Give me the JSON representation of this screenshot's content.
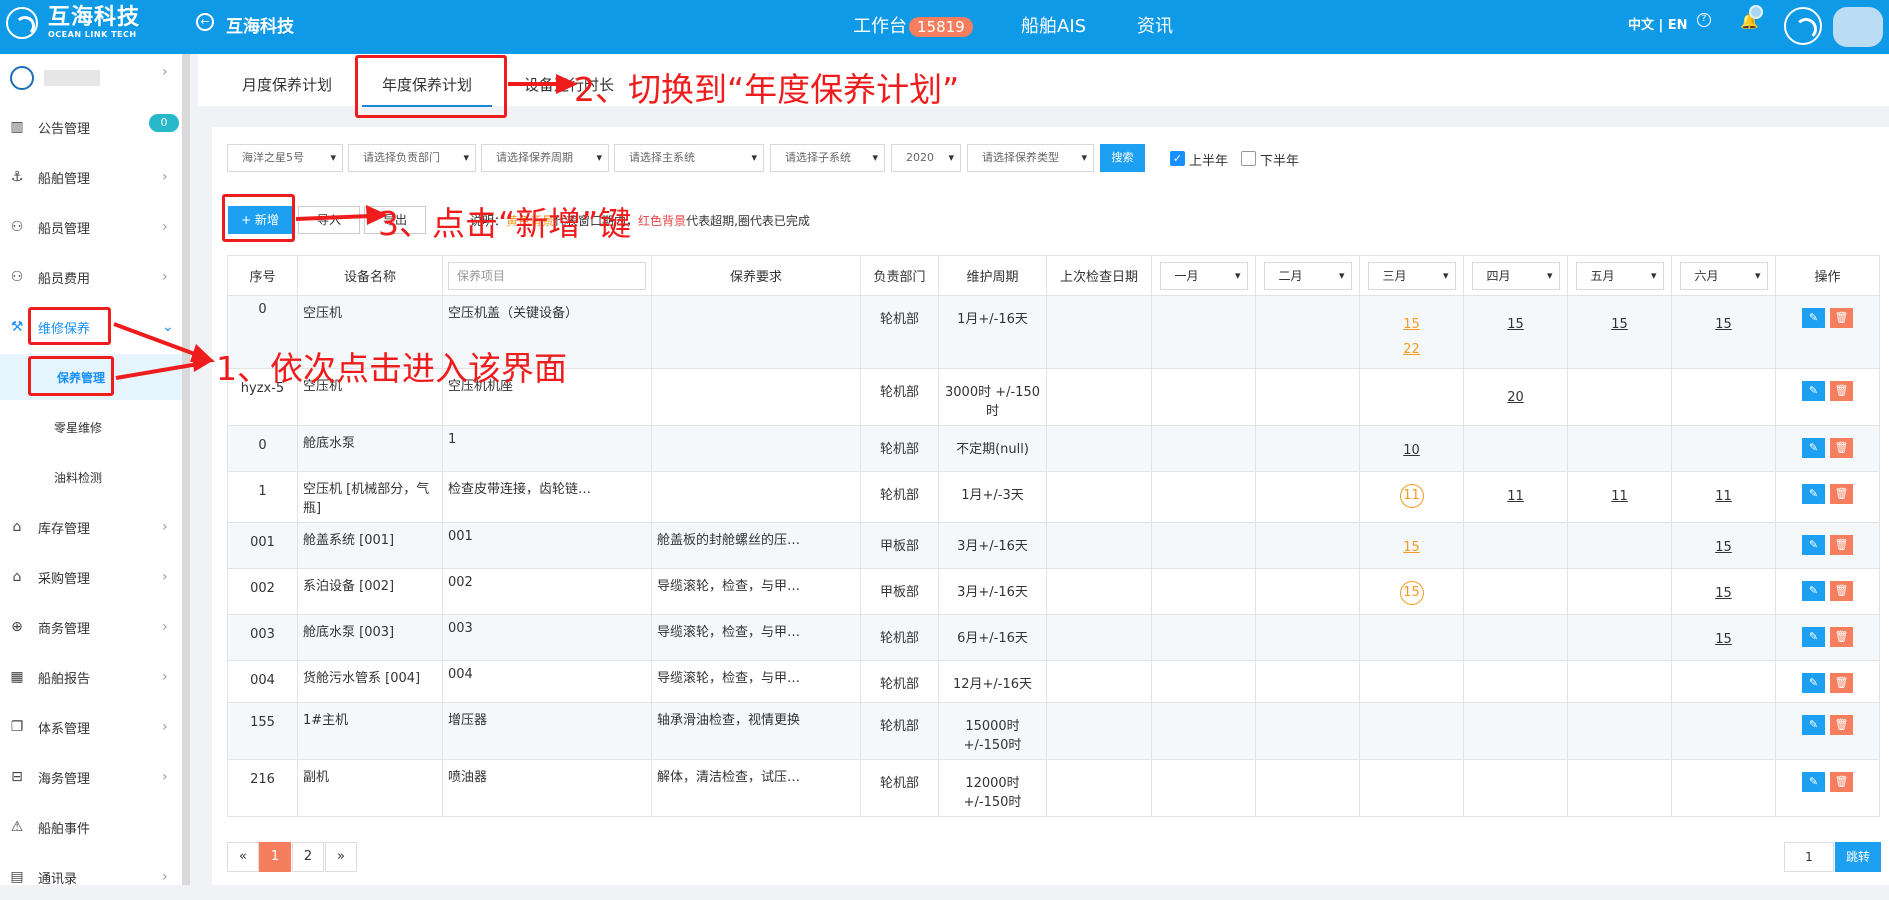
{
  "brand": {
    "name_cn": "互海科技",
    "name_en": "OCEAN LINK TECH"
  },
  "header": {
    "company": "互海科技",
    "workbench": "工作台",
    "workbench_count": "15819",
    "ais": "船舶AIS",
    "news": "资讯",
    "lang": "中文 | EN",
    "help": "?"
  },
  "sidebar": {
    "items": [
      {
        "label": "公告管理",
        "badge": "0"
      },
      {
        "label": "船舶管理"
      },
      {
        "label": "船员管理"
      },
      {
        "label": "船员费用"
      },
      {
        "label": "维修保养"
      },
      {
        "label": "库存管理"
      },
      {
        "label": "采购管理"
      },
      {
        "label": "商务管理"
      },
      {
        "label": "船舶报告"
      },
      {
        "label": "体系管理"
      },
      {
        "label": "海务管理"
      },
      {
        "label": "船舶事件"
      },
      {
        "label": "通讯录"
      }
    ],
    "subitems": [
      {
        "label": "保养管理"
      },
      {
        "label": "零星维修"
      },
      {
        "label": "油料检测"
      }
    ]
  },
  "tabs": {
    "monthly": "月度保养计划",
    "annual": "年度保养计划",
    "equipment_hours": "设备运行时长"
  },
  "filters": {
    "ship": "海洋之星5号",
    "dept": "请选择负责部门",
    "cycle": "请选择保养周期",
    "main_system": "请选择主系统",
    "sub_system": "请选择子系统",
    "year": "2020",
    "type": "请选择保养类型",
    "search": "搜索",
    "first_half": "上半年",
    "second_half": "下半年"
  },
  "toolbar": {
    "add": "+ 新增",
    "import": "导入",
    "export": "导出",
    "legend_prefix": "说明：",
    "legend_orange": "黄色背景",
    "legend_mid": "代表窗口期内，",
    "legend_red": "红色背景",
    "legend_suffix": "代表超期,圈代表已完成"
  },
  "table": {
    "headers": {
      "no": "序号",
      "equipment": "设备名称",
      "item_placeholder": "保养项目",
      "requirement": "保养要求",
      "dept": "负责部门",
      "cycle": "维护周期",
      "last_check": "上次检查日期",
      "op": "操作"
    },
    "months": [
      "一月",
      "二月",
      "三月",
      "四月",
      "五月",
      "六月"
    ],
    "rows": [
      {
        "no": "0",
        "equipment": "空压机",
        "item": "空压机盖（关键设备）",
        "requirement": "",
        "dept": "轮机部",
        "cycle": "1月+/-16天"
      },
      {
        "no": "hyzx-5",
        "equipment": "空压机",
        "item": "空压机机座",
        "requirement": "",
        "dept": "轮机部",
        "cycle": "3000时 +/-150时"
      },
      {
        "no": "0",
        "equipment": "舱底水泵",
        "item": "1",
        "requirement": "",
        "dept": "轮机部",
        "cycle": "不定期(null)"
      },
      {
        "no": "1",
        "equipment": "空压机 [机械部分，气瓶]",
        "item": "检查皮带连接，齿轮链…",
        "requirement": "",
        "dept": "轮机部",
        "cycle": "1月+/-3天"
      },
      {
        "no": "001",
        "equipment": "舱盖系统 [001]",
        "item": "001",
        "requirement": "舱盖板的封舱螺丝的压…",
        "dept": "甲板部",
        "cycle": "3月+/-16天"
      },
      {
        "no": "002",
        "equipment": "系泊设备 [002]",
        "item": "002",
        "requirement": "导缆滚轮，检查，与甲…",
        "dept": "甲板部",
        "cycle": "3月+/-16天"
      },
      {
        "no": "003",
        "equipment": "舱底水泵 [003]",
        "item": "003",
        "requirement": "导缆滚轮，检查，与甲…",
        "dept": "轮机部",
        "cycle": "6月+/-16天"
      },
      {
        "no": "004",
        "equipment": "货舱污水管系 [004]",
        "item": "004",
        "requirement": "导缆滚轮，检查，与甲…",
        "dept": "轮机部",
        "cycle": "12月+/-16天"
      },
      {
        "no": "155",
        "equipment": "1#主机",
        "item": "增压器",
        "requirement": "轴承滑油检查，视情更换",
        "dept": "轮机部",
        "cycle": "15000时 +/-150时"
      },
      {
        "no": "216",
        "equipment": "副机",
        "item": "喷油器",
        "requirement": "解体，清洁检查，试压…",
        "dept": "轮机部",
        "cycle": "12000时 +/-150时"
      }
    ],
    "marks": {
      "r0": {
        "mar1": "15",
        "mar2": "22",
        "apr": "15",
        "may": "15",
        "jun": "15"
      },
      "r1": {
        "apr": "20"
      },
      "r2": {
        "mar": "10"
      },
      "r3": {
        "mar": "11",
        "apr": "11",
        "may": "11",
        "jun": "11"
      },
      "r4": {
        "mar": "15",
        "jun": "15"
      },
      "r5": {
        "mar": "15",
        "jun": "15"
      },
      "r6": {
        "jun": "15"
      }
    }
  },
  "pagination": {
    "prev": "«",
    "p1": "1",
    "p2": "2",
    "next": "»",
    "goto_value": "1",
    "goto": "跳转"
  },
  "annotations": {
    "step1": "1、依次点击进入该界面",
    "step2": "2、切换到“年度保养计划”",
    "step3": "3、点击“新增”键"
  },
  "colors": {
    "primary": "#0f9ae8",
    "accent": "#f47e5d",
    "annotation": "#ee1c1c",
    "window": "#f59a23"
  }
}
